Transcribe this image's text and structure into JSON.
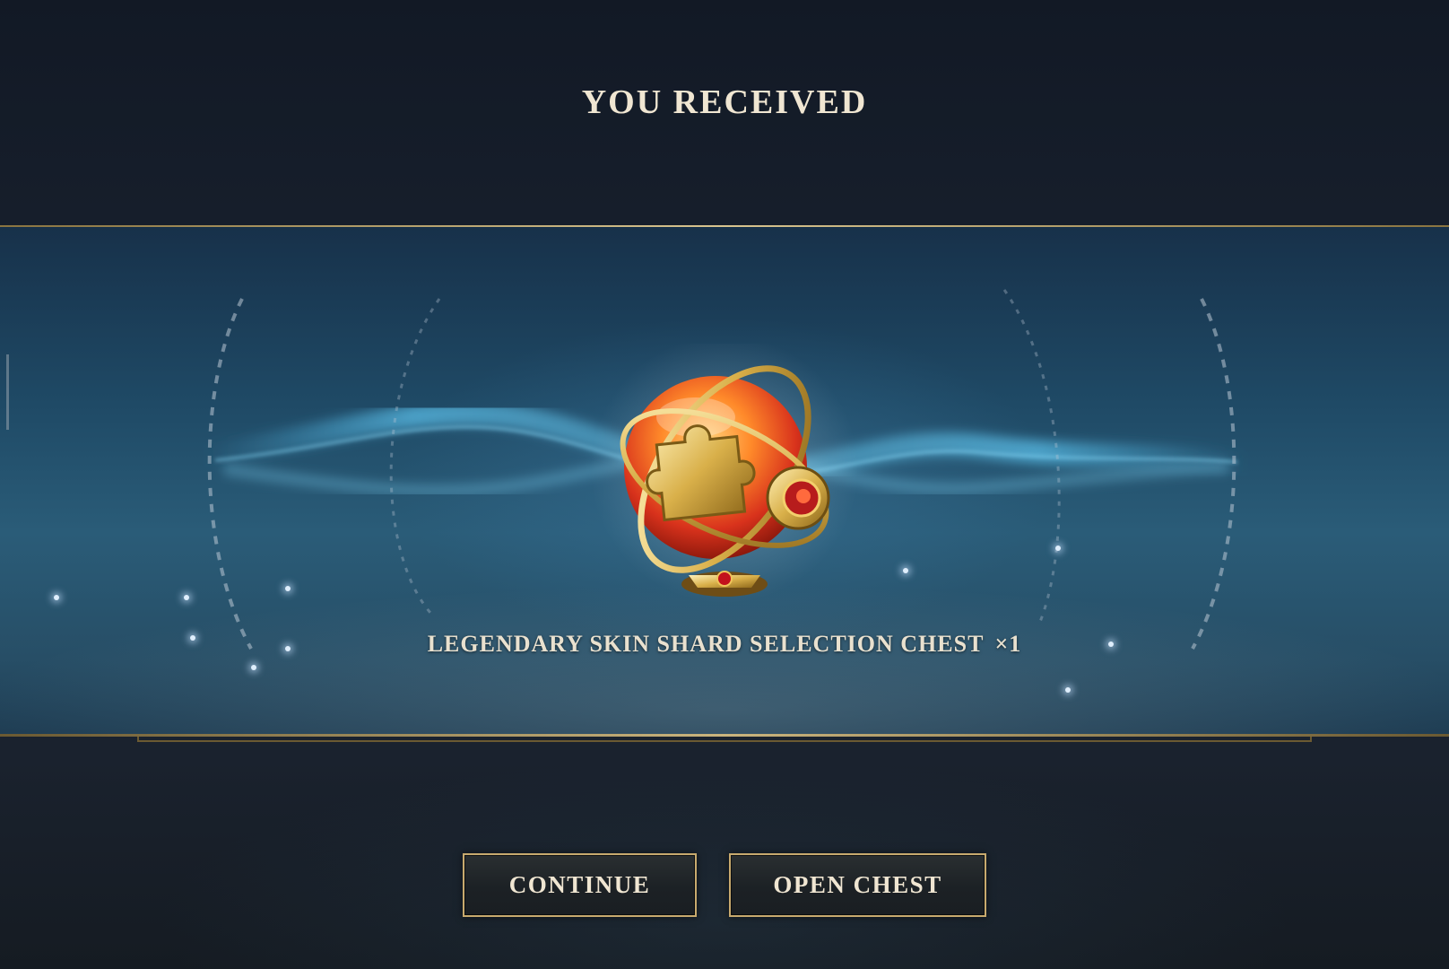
{
  "header": {
    "title": "YOU RECEIVED"
  },
  "reward": {
    "item_name": "LEGENDARY SKIN SHARD SELECTION CHEST",
    "quantity": "×1",
    "icon": "puzzle-piece-orb-icon"
  },
  "actions": {
    "continue_label": "CONTINUE",
    "open_label": "OPEN CHEST"
  },
  "colors": {
    "accent_gold": "#c8aa6e",
    "text_light": "#f0e6d2",
    "band_blue": "#2a5c78"
  }
}
